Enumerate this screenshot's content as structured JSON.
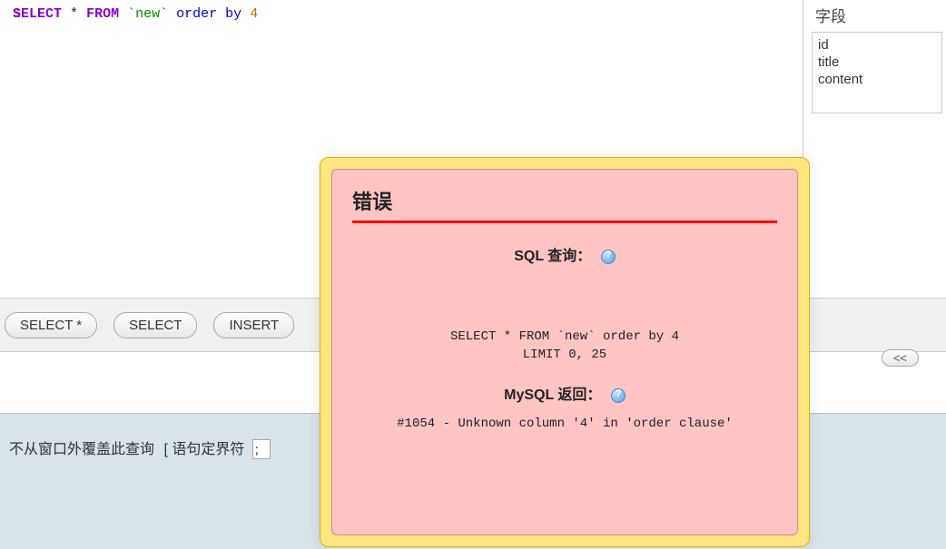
{
  "editor": {
    "line_num": "1",
    "kw_select": "SELECT",
    "star": "*",
    "kw_from": "FROM",
    "table": "`new`",
    "kw_order": "order",
    "kw_by": "by",
    "num": "4"
  },
  "fields": {
    "header": "字段",
    "items": [
      "id",
      "title",
      "content"
    ]
  },
  "buttons": {
    "select_star": "SELECT *",
    "select": "SELECT",
    "insert": "INSERT",
    "collapse": "<<"
  },
  "bottom": {
    "no_overwrite": "不从窗口外覆盖此查询",
    "delim_label": "[ 语句定界符",
    "delim_value": ";"
  },
  "error": {
    "title": "错误",
    "sql_label": "SQL 查询：",
    "sql_text": "SELECT * FROM `new` order by 4\nLIMIT 0, 25",
    "mysql_label": "MySQL 返回：",
    "code": "#1054 - Unknown column '4' in 'order clause'"
  }
}
